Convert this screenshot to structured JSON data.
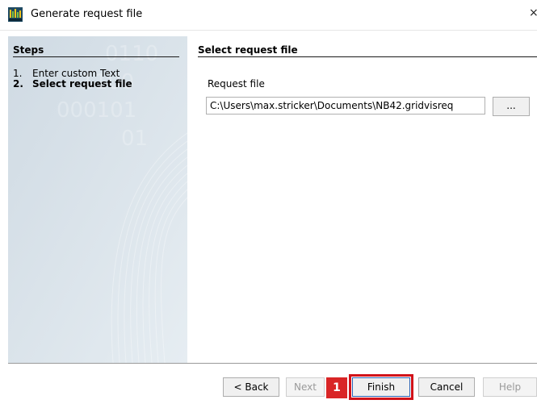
{
  "window": {
    "title": "Generate request file",
    "close_glyph": "×"
  },
  "steps": {
    "heading": "Steps",
    "items": [
      {
        "num": "1.",
        "label": "Enter custom Text"
      },
      {
        "num": "2.",
        "label": "Select request file"
      }
    ]
  },
  "content": {
    "heading": "Select request file",
    "field_label": "Request file",
    "field_value": "C:\\Users\\max.stricker\\Documents\\NB42.gridvisreq",
    "browse_label": "..."
  },
  "buttons": {
    "back": "< Back",
    "next": "Next",
    "finish": "Finish",
    "cancel": "Cancel",
    "help": "Help"
  },
  "annotation": {
    "marker": "1",
    "highlight_color": "#d1131a"
  },
  "icons": {
    "app": "app-icon",
    "close": "close-icon"
  }
}
